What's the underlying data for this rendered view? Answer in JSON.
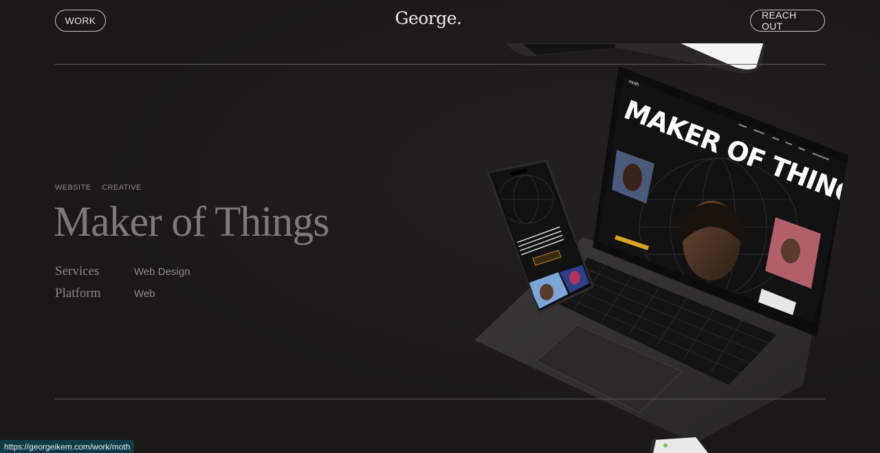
{
  "header": {
    "work_label": "WORK",
    "logo": "George.",
    "reach_label": "REACH OUT"
  },
  "project": {
    "tags": [
      "WEBSITE",
      "CREATIVE"
    ],
    "title": "Maker of Things",
    "meta": [
      {
        "key": "Services",
        "value": "Web Design"
      },
      {
        "key": "Platform",
        "value": "Web"
      }
    ]
  },
  "mockup": {
    "laptop_headline": "MAKER OF THINGS.",
    "laptop_brand": "moth",
    "laptop_nav": [
      "Music",
      "Resources",
      "Events",
      "Store",
      "More",
      "Reach out here"
    ],
    "phone_cta": "SEE ALL RELEASES",
    "phone_text": "MOTH IS THE LEADING NETWORK AND CREATIVE COLLECTIVE SUPPORTING EMERGING ARTISTS",
    "accent_color": "#d9a21f"
  },
  "status_bar": {
    "url": "https://georgeikem.com/work/moth"
  }
}
